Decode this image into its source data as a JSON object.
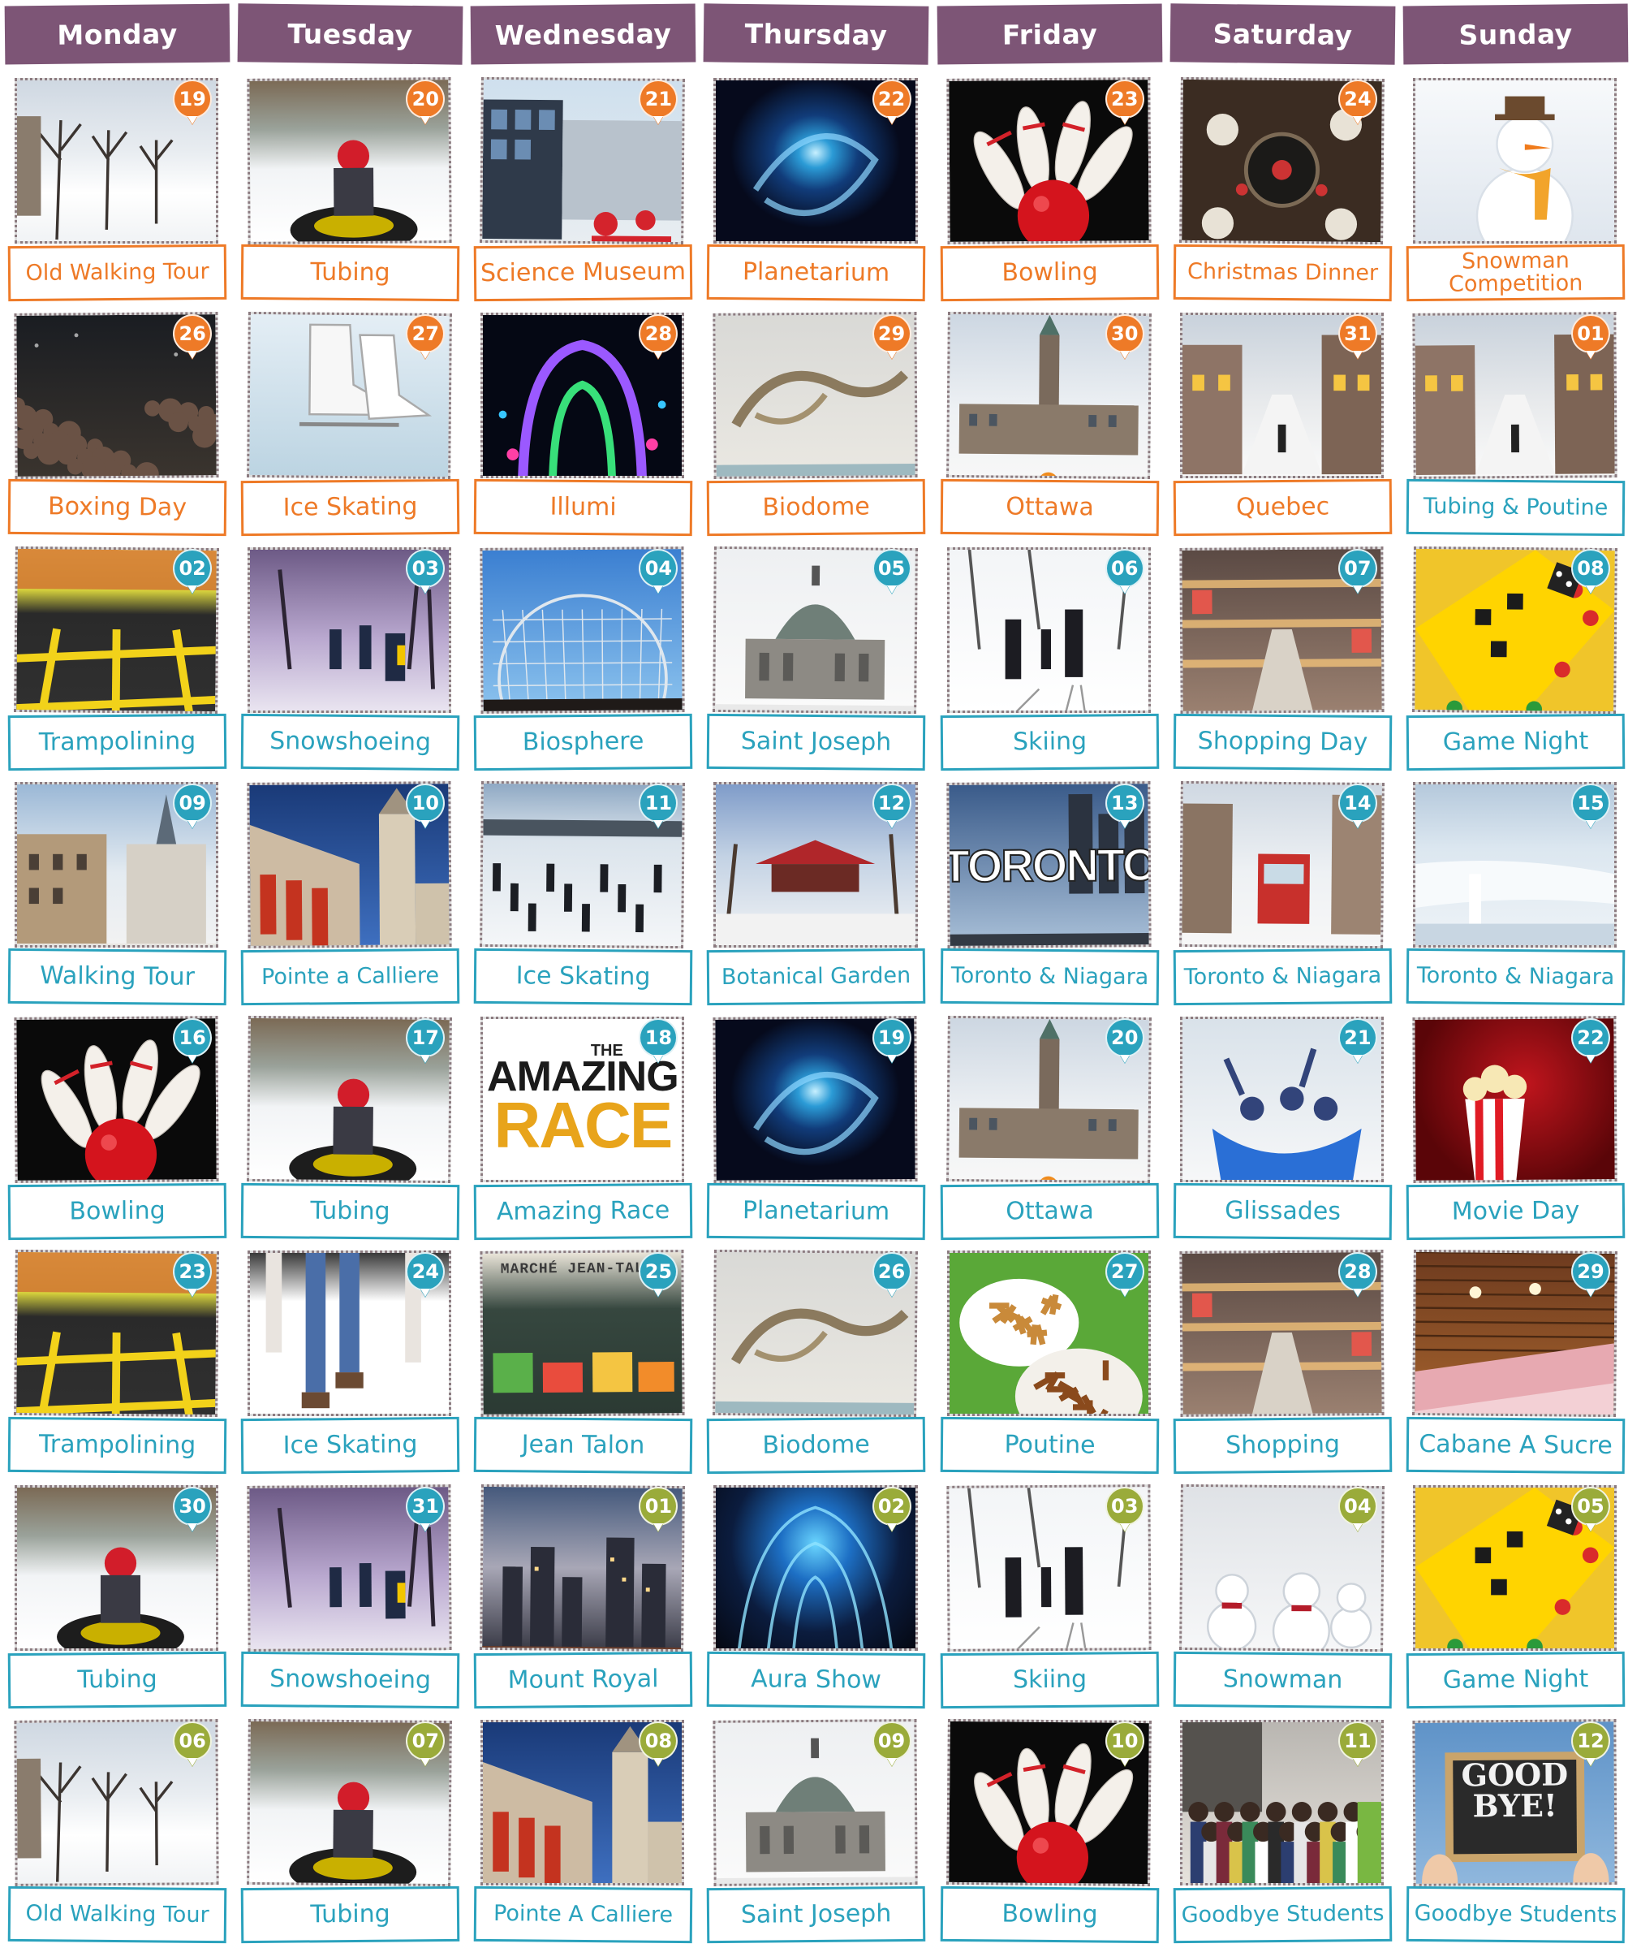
{
  "days": [
    "Monday",
    "Tuesday",
    "Wednesday",
    "Thursday",
    "Friday",
    "Saturday",
    "Sunday"
  ],
  "colors": {
    "header": "#7d5576",
    "orange": "#ee7a27",
    "teal": "#2aa2bd",
    "olive": "#9aab3a"
  },
  "rows": [
    {
      "accent": "orange",
      "cells": [
        {
          "day": "19",
          "label": "Old Walking Tour",
          "scene": "winter-street"
        },
        {
          "day": "20",
          "label": "Tubing",
          "scene": "snow-tube"
        },
        {
          "day": "21",
          "label": "Science Museum",
          "scene": "museum"
        },
        {
          "day": "22",
          "label": "Planetarium",
          "scene": "galaxy"
        },
        {
          "day": "23",
          "label": "Bowling",
          "scene": "bowling"
        },
        {
          "day": "24",
          "label": "Christmas Dinner",
          "scene": "dinner"
        },
        {
          "day": "",
          "label": "Snowman Competition",
          "scene": "snowman"
        }
      ]
    },
    {
      "accent": "orange",
      "cells": [
        {
          "day": "26",
          "label": "Boxing Day",
          "scene": "crowd"
        },
        {
          "day": "27",
          "label": "Ice Skating",
          "scene": "skate"
        },
        {
          "day": "28",
          "label": "Illumi",
          "scene": "lights"
        },
        {
          "day": "29",
          "label": "Biodome",
          "scene": "biodome"
        },
        {
          "day": "30",
          "label": "Ottawa",
          "scene": "parliament"
        },
        {
          "day": "31",
          "label": "Quebec",
          "scene": "quebec-street"
        },
        {
          "day": "01",
          "label": "Tubing & Poutine",
          "scene": "quebec-street",
          "accent": "teal"
        }
      ]
    },
    {
      "accent": "teal",
      "cells": [
        {
          "day": "02",
          "label": "Trampolining",
          "scene": "trampoline"
        },
        {
          "day": "03",
          "label": "Snowshoeing",
          "scene": "snowshoe"
        },
        {
          "day": "04",
          "label": "Biosphere",
          "scene": "dome"
        },
        {
          "day": "05",
          "label": "Saint Joseph",
          "scene": "oratory"
        },
        {
          "day": "06",
          "label": "Skiing",
          "scene": "ski"
        },
        {
          "day": "07",
          "label": "Shopping Day",
          "scene": "mall"
        },
        {
          "day": "08",
          "label": "Game Night",
          "scene": "boardgame"
        }
      ]
    },
    {
      "accent": "teal",
      "cells": [
        {
          "day": "09",
          "label": "Walking Tour",
          "scene": "old-town"
        },
        {
          "day": "10",
          "label": "Pointe a Calliere",
          "scene": "building"
        },
        {
          "day": "11",
          "label": "Ice Skating",
          "scene": "rink"
        },
        {
          "day": "12",
          "label": "Botanical Garden",
          "scene": "garden"
        },
        {
          "day": "13",
          "label": "Toronto & Niagara",
          "scene": "toronto"
        },
        {
          "day": "14",
          "label": "Toronto & Niagara",
          "scene": "streetcar"
        },
        {
          "day": "15",
          "label": "Toronto & Niagara",
          "scene": "niagara"
        }
      ]
    },
    {
      "accent": "teal",
      "cells": [
        {
          "day": "16",
          "label": "Bowling",
          "scene": "bowling"
        },
        {
          "day": "17",
          "label": "Tubing",
          "scene": "snow-tube"
        },
        {
          "day": "18",
          "label": "Amazing Race",
          "scene": "amazing-race"
        },
        {
          "day": "19",
          "label": "Planetarium",
          "scene": "galaxy"
        },
        {
          "day": "20",
          "label": "Ottawa",
          "scene": "parliament"
        },
        {
          "day": "21",
          "label": "Glissades",
          "scene": "glissades"
        },
        {
          "day": "22",
          "label": "Movie Day",
          "scene": "popcorn"
        }
      ]
    },
    {
      "accent": "teal",
      "cells": [
        {
          "day": "23",
          "label": "Trampolining",
          "scene": "trampoline"
        },
        {
          "day": "24",
          "label": "Ice Skating",
          "scene": "skate-legs"
        },
        {
          "day": "25",
          "label": "Jean Talon",
          "scene": "market"
        },
        {
          "day": "26",
          "label": "Biodome",
          "scene": "biodome"
        },
        {
          "day": "27",
          "label": "Poutine",
          "scene": "poutine"
        },
        {
          "day": "28",
          "label": "Shopping",
          "scene": "mall"
        },
        {
          "day": "29",
          "label": "Cabane A Sucre",
          "scene": "cabin"
        }
      ]
    },
    {
      "accent": "teal",
      "badge": "olive",
      "cells": [
        {
          "day": "30",
          "label": "Tubing",
          "scene": "snow-tube",
          "badge": "teal"
        },
        {
          "day": "31",
          "label": "Snowshoeing",
          "scene": "snowshoe",
          "badge": "teal"
        },
        {
          "day": "01",
          "label": "Mount Royal",
          "scene": "skyline"
        },
        {
          "day": "02",
          "label": "Aura Show",
          "scene": "aura"
        },
        {
          "day": "03",
          "label": "Skiing",
          "scene": "ski"
        },
        {
          "day": "04",
          "label": "Snowman",
          "scene": "snowmen"
        },
        {
          "day": "05",
          "label": "Game Night",
          "scene": "boardgame"
        }
      ]
    },
    {
      "accent": "teal",
      "badge": "olive",
      "cells": [
        {
          "day": "06",
          "label": "Old Walking Tour",
          "scene": "winter-street"
        },
        {
          "day": "07",
          "label": "Tubing",
          "scene": "snow-tube"
        },
        {
          "day": "08",
          "label": "Pointe A Calliere",
          "scene": "building"
        },
        {
          "day": "09",
          "label": "Saint Joseph",
          "scene": "oratory"
        },
        {
          "day": "10",
          "label": "Bowling",
          "scene": "bowling"
        },
        {
          "day": "11",
          "label": "Goodbye Students",
          "scene": "group"
        },
        {
          "day": "12",
          "label": "Goodbye Students",
          "scene": "goodbye"
        }
      ]
    }
  ],
  "photo_text": {
    "amazing_the": "THE",
    "amazing_1": "AMAZING",
    "amazing_2": "RACE",
    "toronto": "TORONTO",
    "market": "MARCHÉ JEAN-TALON",
    "goodbye_1": "GOOD",
    "goodbye_2": "BYE!"
  }
}
